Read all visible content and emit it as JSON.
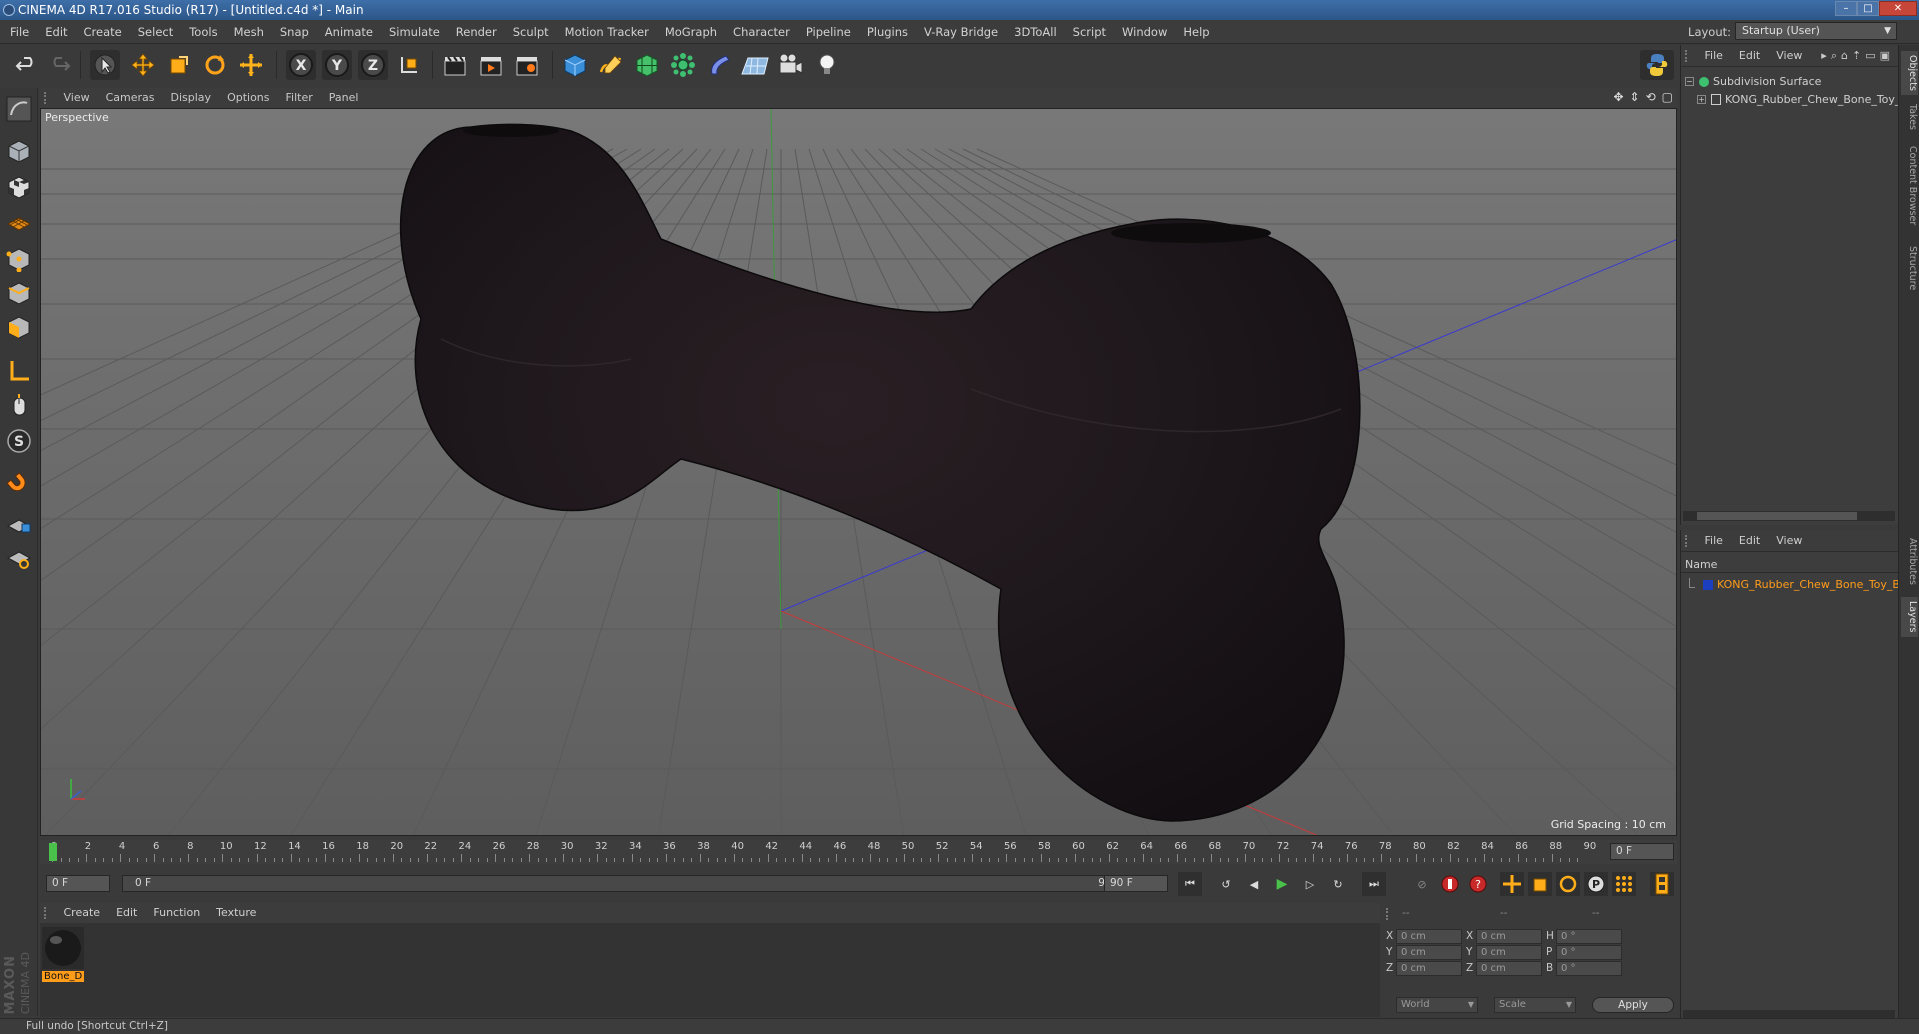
{
  "window": {
    "title": "CINEMA 4D R17.016 Studio (R17) - [Untitled.c4d *] - Main",
    "min_label": "–",
    "max_label": "□",
    "close_label": "✕"
  },
  "menubar": {
    "items": [
      "File",
      "Edit",
      "Create",
      "Select",
      "Tools",
      "Mesh",
      "Snap",
      "Animate",
      "Simulate",
      "Render",
      "Sculpt",
      "Motion Tracker",
      "MoGraph",
      "Character",
      "Pipeline",
      "Plugins",
      "V-Ray Bridge",
      "3DToAll",
      "Script",
      "Window",
      "Help"
    ],
    "layout_label": "Layout:",
    "layout_value": "Startup (User)"
  },
  "toolbar": {
    "axis_x": "X",
    "axis_y": "Y",
    "axis_z": "Z"
  },
  "viewport": {
    "menu": [
      "View",
      "Cameras",
      "Display",
      "Options",
      "Filter",
      "Panel"
    ],
    "camera_label": "Perspective",
    "grid_spacing": "Grid Spacing : 10 cm"
  },
  "timeline": {
    "ticks": [
      "0",
      "2",
      "4",
      "6",
      "8",
      "10",
      "12",
      "14",
      "16",
      "18",
      "20",
      "22",
      "24",
      "26",
      "28",
      "30",
      "32",
      "34",
      "36",
      "38",
      "40",
      "42",
      "44",
      "46",
      "48",
      "50",
      "52",
      "54",
      "56",
      "58",
      "60",
      "62",
      "64",
      "66",
      "68",
      "70",
      "72",
      "74",
      "76",
      "78",
      "80",
      "82",
      "84",
      "86",
      "88",
      "90"
    ],
    "current_frame": "0 F",
    "start_field": "0 F",
    "range_start": "0 F",
    "range_end": "90 F",
    "end_field": "90 F"
  },
  "material_manager": {
    "menu": [
      "Create",
      "Edit",
      "Function",
      "Texture"
    ],
    "materials": [
      {
        "name": "Bone_D"
      }
    ]
  },
  "coordinates": {
    "header": [
      "--",
      "--",
      "--"
    ],
    "rows": [
      {
        "a": "X",
        "v1": "0 cm",
        "b": "X",
        "v2": "0 cm",
        "c": "H",
        "v3": "0 °"
      },
      {
        "a": "Y",
        "v1": "0 cm",
        "b": "Y",
        "v2": "0 cm",
        "c": "P",
        "v3": "0 °"
      },
      {
        "a": "Z",
        "v1": "0 cm",
        "b": "Z",
        "v2": "0 cm",
        "c": "B",
        "v3": "0 °"
      }
    ],
    "world": "World",
    "scale": "Scale",
    "apply": "Apply"
  },
  "object_manager": {
    "menu": [
      "File",
      "Edit",
      "View"
    ],
    "objects": [
      "Subdivision Surface",
      "KONG_Rubber_Chew_Bone_Toy_"
    ]
  },
  "layer_manager": {
    "menu": [
      "File",
      "Edit",
      "View"
    ],
    "column": "Name",
    "layers": [
      "KONG_Rubber_Chew_Bone_Toy_B"
    ]
  },
  "side_tabs": [
    "Objects",
    "Takes",
    "Content Browser",
    "Structure",
    "Attributes",
    "Layers"
  ],
  "brand": {
    "maxon": "MAXON",
    "c4d": "CINEMA 4D"
  },
  "status": "Full undo [Shortcut Ctrl+Z]",
  "colors": {
    "accent_orange": "#ff9c1a",
    "selection_blue": "#1c3fbf",
    "titlebar_blue": "#3e6fa8",
    "play_green": "#49c14a"
  }
}
